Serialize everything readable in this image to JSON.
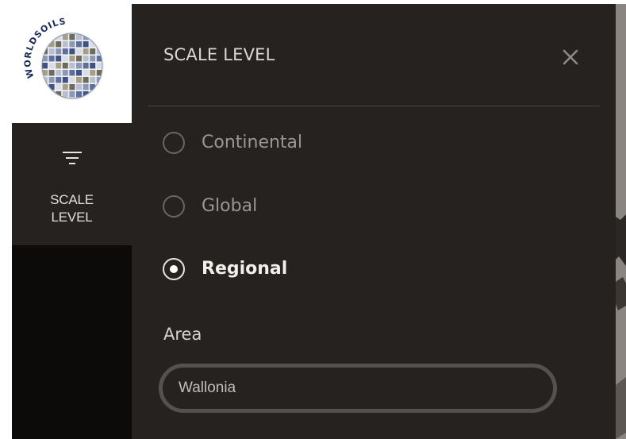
{
  "logo": {
    "text": "WORLDSOILS"
  },
  "rail": {
    "tab_label": "SCALE\nLEVEL",
    "tab_icon": "filter-icon"
  },
  "panel": {
    "title": "SCALE LEVEL",
    "close_icon": "close-icon",
    "options": [
      {
        "label": "Continental",
        "selected": false
      },
      {
        "label": "Global",
        "selected": false
      },
      {
        "label": "Regional",
        "selected": true
      }
    ],
    "area": {
      "label": "Area",
      "value": "Wallonia"
    }
  },
  "colors": {
    "panel_bg": "#26221f",
    "rail_bg": "#0d0b09",
    "selected_text": "#f2eeea",
    "unselected_text": "#9b9691"
  }
}
